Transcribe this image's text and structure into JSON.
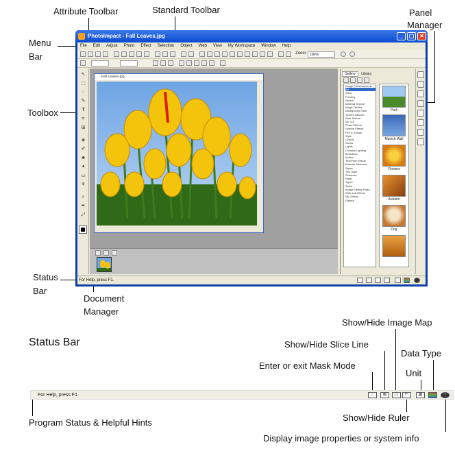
{
  "callouts": {
    "attribute_toolbar": "Attribute Toolbar",
    "standard_toolbar": "Standard Toolbar",
    "panel_manager_1": "Panel",
    "panel_manager_2": "Manager",
    "menu_bar_1": "Menu",
    "menu_bar_2": "Bar",
    "toolbox": "Toolbox",
    "status_bar_1": "Status",
    "status_bar_2": "Bar",
    "document_manager_1": "Document",
    "document_manager_2": "Manager"
  },
  "window": {
    "title": "PhotoImpact - Fall Leaves.jpg",
    "buttons": [
      "_",
      "▢",
      "✕"
    ]
  },
  "menu": [
    "File",
    "Edit",
    "Adjust",
    "Photo",
    "Effect",
    "Selection",
    "Object",
    "Web",
    "View",
    "My Workspace",
    "Window",
    "Help"
  ],
  "standard_toolbar": {
    "zoom_label": "Zoom",
    "zoom_value": "100%"
  },
  "image_window": {
    "title": "Fall Leaves.jpg"
  },
  "panel": {
    "tabs": [
      "Gallery",
      "Library"
    ],
    "tree": [
      "Image Enhancements",
      "Art",
      "Artist",
      "Painting",
      "Sketch",
      "Material Texture",
      "Magic Texture",
      "Background Fade",
      "Texture Mixture",
      "Web Texture",
      "Ice Cut",
      "Photo Effects",
      "Special Effects",
      "Fire & Smoke",
      "Style",
      "Clouds",
      "Glows",
      "Lights",
      "Creative Lighting",
      "Animation",
      "Motion",
      "Text/Path Effects",
      "Material Attributes",
      "Styles",
      "Text Style",
      "Shadows",
      "Warp",
      "Types",
      "Tasks",
      "Image Editing Tasks",
      "Web and Others",
      "My Gallery",
      "Gallery"
    ],
    "selected_index": 1,
    "gallery": [
      "Park",
      "Munich Wall",
      "Flowers",
      "Autumn",
      "Dog"
    ]
  },
  "status_bar": {
    "text": "For Help, press F1."
  },
  "status_detail": {
    "heading": "Status Bar",
    "text": "For Help, press F1.",
    "labels": {
      "image_map": "Show/Hide Image Map",
      "slice_line": "Show/Hide Slice Line",
      "data_type": "Data Type",
      "mask_mode": "Enter or exit Mask Mode",
      "unit": "Unit",
      "program_status": "Program Status & Helpful Hints",
      "ruler": "Show/Hide Ruler",
      "properties": "Display image properties or system info"
    }
  },
  "colors": {
    "titlebar": "#0a4ad0",
    "window_bg": "#ece9d8",
    "selection": "#316ac5",
    "tulip": "#f4c30c"
  }
}
